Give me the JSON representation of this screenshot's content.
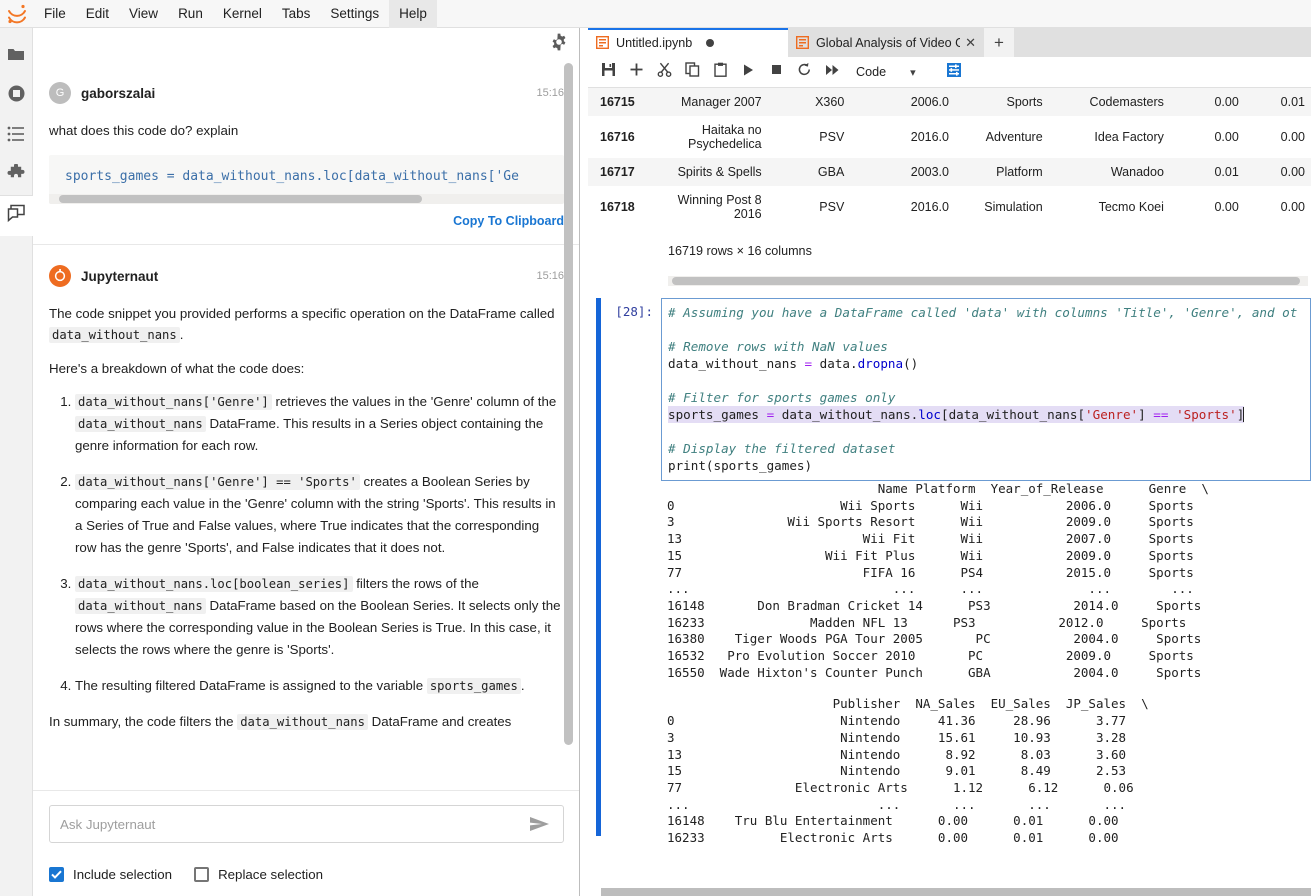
{
  "menubar": {
    "logo_icon": "jupyter-logo",
    "items": [
      {
        "label": "File"
      },
      {
        "label": "Edit"
      },
      {
        "label": "View"
      },
      {
        "label": "Run"
      },
      {
        "label": "Kernel"
      },
      {
        "label": "Tabs"
      },
      {
        "label": "Settings"
      },
      {
        "label": "Help"
      }
    ],
    "active": "Help"
  },
  "activitybar": {
    "items": [
      {
        "name": "file-browser-icon",
        "label": "File Browser"
      },
      {
        "name": "running-terminals-icon",
        "label": "Running Terminals and Kernels"
      },
      {
        "name": "table-of-contents-icon",
        "label": "Table of Contents"
      },
      {
        "name": "extension-manager-icon",
        "label": "Extension Manager"
      },
      {
        "name": "chat-icon",
        "label": "Jupyter AI Chat"
      }
    ],
    "selected": "chat-icon"
  },
  "chat": {
    "settings_icon": "gear-icon",
    "messages": [
      {
        "author": "gaborszalai",
        "avatar_letter": "G",
        "avatar_kind": "user",
        "time": "15:16",
        "text": "what does this code do? explain",
        "code": "sports_games = data_without_nans.loc[data_without_nans['Ge",
        "copy_label": "Copy To Clipboard"
      },
      {
        "author": "Jupyternaut",
        "avatar_kind": "bot",
        "time": "15:16",
        "para1_a": "The code snippet you provided performs a specific operation on the DataFrame called ",
        "para1_code": "data_without_nans",
        "para1_b": ".",
        "para2": "Here's a breakdown of what the code does:",
        "steps": [
          {
            "code1": "data_without_nans['Genre']",
            "t1": " retrieves the values in the 'Genre' column of the ",
            "code2": "data_without_nans",
            "t2": " DataFrame. This results in a Series object containing the genre information for each row."
          },
          {
            "code1": "data_without_nans['Genre'] == 'Sports'",
            "t1": " creates a Boolean Series by comparing each value in the 'Genre' column with the string 'Sports'. This results in a Series of True and False values, where True indicates that the corresponding row has the genre 'Sports', and False indicates that it does not.",
            "code2": "",
            "t2": ""
          },
          {
            "code1": "data_without_nans.loc[boolean_series]",
            "t1": " filters the rows of the ",
            "code2": "data_without_nans",
            "t2": " DataFrame based on the Boolean Series. It selects only the rows where the corresponding value in the Boolean Series is True. In this case, it selects the rows where the genre is 'Sports'."
          },
          {
            "code1": "",
            "t1": "The resulting filtered DataFrame is assigned to the variable ",
            "code2": "sports_games",
            "t2": "."
          }
        ],
        "summary_a": "In summary, the code filters the ",
        "summary_code": "data_without_nans",
        "summary_b": " DataFrame and creates"
      }
    ],
    "input": {
      "value": "",
      "placeholder": "Ask Jupyternaut",
      "send_icon": "send-arrow-icon"
    },
    "checkboxes": [
      {
        "label": "Include selection",
        "checked": true
      },
      {
        "label": "Replace selection",
        "checked": false
      }
    ]
  },
  "notebook": {
    "tabs": [
      {
        "title": "Untitled.ipynb",
        "icon": "notebook-icon",
        "active": true,
        "dirty": true,
        "closable": false
      },
      {
        "title": "Global Analysis of Video Ga",
        "icon": "notebook-icon",
        "active": false,
        "dirty": false,
        "closable": true
      }
    ],
    "add_tab_label": "+",
    "toolbar": {
      "buttons": [
        {
          "name": "save-button",
          "icon": "save-icon"
        },
        {
          "name": "insert-cell-button",
          "icon": "plus-icon"
        },
        {
          "name": "cut-cell-button",
          "icon": "scissors-icon"
        },
        {
          "name": "copy-cell-button",
          "icon": "copy-icon"
        },
        {
          "name": "paste-cell-button",
          "icon": "paste-icon"
        },
        {
          "name": "run-cell-button",
          "icon": "play-icon"
        },
        {
          "name": "interrupt-kernel-button",
          "icon": "stop-icon"
        },
        {
          "name": "restart-kernel-button",
          "icon": "restart-icon"
        },
        {
          "name": "restart-run-all-button",
          "icon": "fast-forward-icon"
        }
      ],
      "cell_type": "Code",
      "cell_type_caret": "chevron-down-icon",
      "debugger_icon": "debugger-icon"
    },
    "dataframe": {
      "rows": [
        {
          "index": "16715",
          "name": "Manager 2007",
          "platform": "X360",
          "year": "2006.0",
          "genre": "Sports",
          "publisher": "Codemasters",
          "na": "0.00",
          "eu": "0.01"
        },
        {
          "index": "16716",
          "name": "Haitaka no Psychedelica",
          "platform": "PSV",
          "year": "2016.0",
          "genre": "Adventure",
          "publisher": "Idea Factory",
          "na": "0.00",
          "eu": "0.00"
        },
        {
          "index": "16717",
          "name": "Spirits & Spells",
          "platform": "GBA",
          "year": "2003.0",
          "genre": "Platform",
          "publisher": "Wanadoo",
          "na": "0.01",
          "eu": "0.00"
        },
        {
          "index": "16718",
          "name": "Winning Post 8 2016",
          "platform": "PSV",
          "year": "2016.0",
          "genre": "Simulation",
          "publisher": "Tecmo Koei",
          "na": "0.00",
          "eu": "0.00"
        }
      ],
      "shape_note": "16719 rows × 16 columns"
    },
    "cell": {
      "prompt": "[28]:",
      "lines": [
        "# Assuming you have a DataFrame called 'data' with columns 'Title', 'Genre', and ot",
        "",
        "# Remove rows with NaN values",
        "data_without_nans = data.dropna()",
        "",
        "# Filter for sports games only",
        "sports_games = data_without_nans.loc[data_without_nans['Genre'] == 'Sports']",
        "",
        "# Display the filtered dataset",
        "print(sports_games)"
      ]
    },
    "output": {
      "block1": [
        "                            Name Platform  Year_of_Release      Genre  \\",
        "0                      Wii Sports      Wii           2006.0     Sports",
        "3               Wii Sports Resort      Wii           2009.0     Sports",
        "13                        Wii Fit      Wii           2007.0     Sports",
        "15                   Wii Fit Plus      Wii           2009.0     Sports",
        "77                        FIFA 16      PS4           2015.0     Sports",
        "...                           ...      ...              ...        ...",
        "16148       Don Bradman Cricket 14      PS3           2014.0     Sports",
        "16233              Madden NFL 13      PS3           2012.0     Sports",
        "16380    Tiger Woods PGA Tour 2005       PC           2004.0     Sports",
        "16532   Pro Evolution Soccer 2010       PC           2009.0     Sports",
        "16550  Wade Hixton's Counter Punch      GBA           2004.0     Sports"
      ],
      "block2": [
        "                      Publisher  NA_Sales  EU_Sales  JP_Sales  \\",
        "0                      Nintendo     41.36     28.96      3.77",
        "3                      Nintendo     15.61     10.93      3.28",
        "13                     Nintendo      8.92      8.03      3.60",
        "15                     Nintendo      9.01      8.49      2.53",
        "77               Electronic Arts      1.12      6.12      0.06",
        "...                         ...       ...       ...       ...",
        "16148    Tru Blu Entertainment      0.00      0.01      0.00",
        "16233          Electronic Arts      0.00      0.01      0.00"
      ]
    }
  },
  "colors": {
    "accent_blue": "#1976d2",
    "cell_bar_blue": "#1565d8",
    "jupyter_orange": "#ee6c21",
    "tab_active_underline": "#1a73e8",
    "selection_highlight": "#e4ddf5"
  }
}
